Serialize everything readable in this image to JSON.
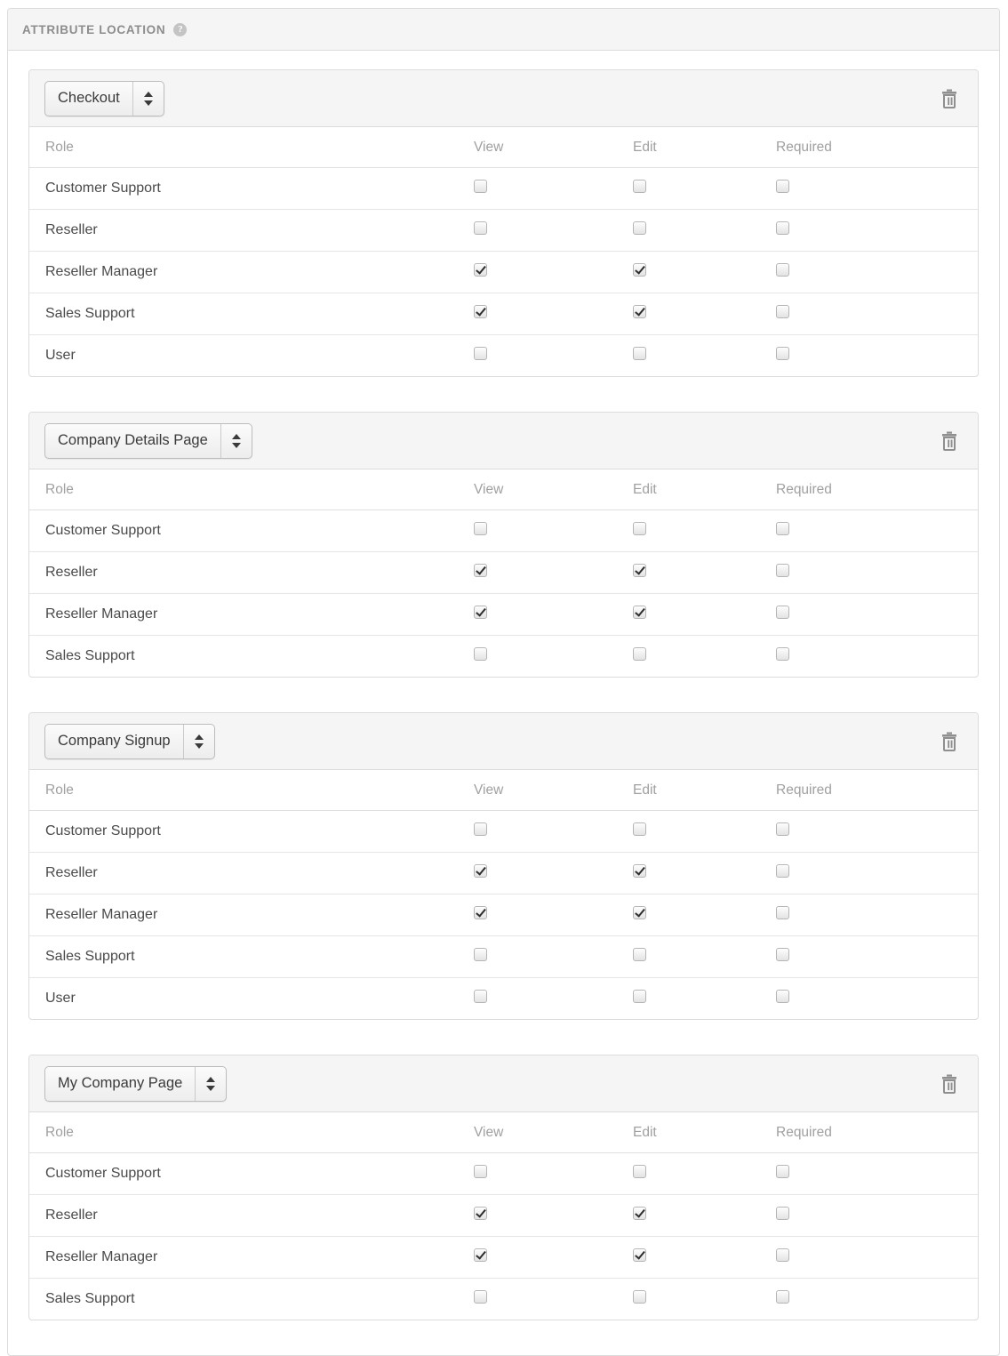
{
  "panel": {
    "title": "ATTRIBUTE LOCATION",
    "help_icon": "help-circle-icon",
    "help_glyph": "?"
  },
  "table": {
    "columns": [
      "Role",
      "View",
      "Edit",
      "Required"
    ]
  },
  "icons": {
    "trash": "trash-icon",
    "select_arrows": "updown-arrows-icon"
  },
  "locations": [
    {
      "name": "Checkout",
      "delete_label": "Delete location",
      "rows": [
        {
          "role": "Customer Support",
          "view": false,
          "edit": false,
          "required": false
        },
        {
          "role": "Reseller",
          "view": false,
          "edit": false,
          "required": false
        },
        {
          "role": "Reseller Manager",
          "view": true,
          "edit": true,
          "required": false
        },
        {
          "role": "Sales Support",
          "view": true,
          "edit": true,
          "required": false
        },
        {
          "role": "User",
          "view": false,
          "edit": false,
          "required": false
        }
      ]
    },
    {
      "name": "Company Details Page",
      "delete_label": "Delete location",
      "rows": [
        {
          "role": "Customer Support",
          "view": false,
          "edit": false,
          "required": false
        },
        {
          "role": "Reseller",
          "view": true,
          "edit": true,
          "required": false
        },
        {
          "role": "Reseller Manager",
          "view": true,
          "edit": true,
          "required": false
        },
        {
          "role": "Sales Support",
          "view": false,
          "edit": false,
          "required": false
        }
      ]
    },
    {
      "name": "Company Signup",
      "delete_label": "Delete location",
      "rows": [
        {
          "role": "Customer Support",
          "view": false,
          "edit": false,
          "required": false
        },
        {
          "role": "Reseller",
          "view": true,
          "edit": true,
          "required": false
        },
        {
          "role": "Reseller Manager",
          "view": true,
          "edit": true,
          "required": false
        },
        {
          "role": "Sales Support",
          "view": false,
          "edit": false,
          "required": false
        },
        {
          "role": "User",
          "view": false,
          "edit": false,
          "required": false
        }
      ]
    },
    {
      "name": "My Company Page",
      "delete_label": "Delete location",
      "rows": [
        {
          "role": "Customer Support",
          "view": false,
          "edit": false,
          "required": false
        },
        {
          "role": "Reseller",
          "view": true,
          "edit": true,
          "required": false
        },
        {
          "role": "Reseller Manager",
          "view": true,
          "edit": true,
          "required": false
        },
        {
          "role": "Sales Support",
          "view": false,
          "edit": false,
          "required": false
        }
      ]
    }
  ]
}
